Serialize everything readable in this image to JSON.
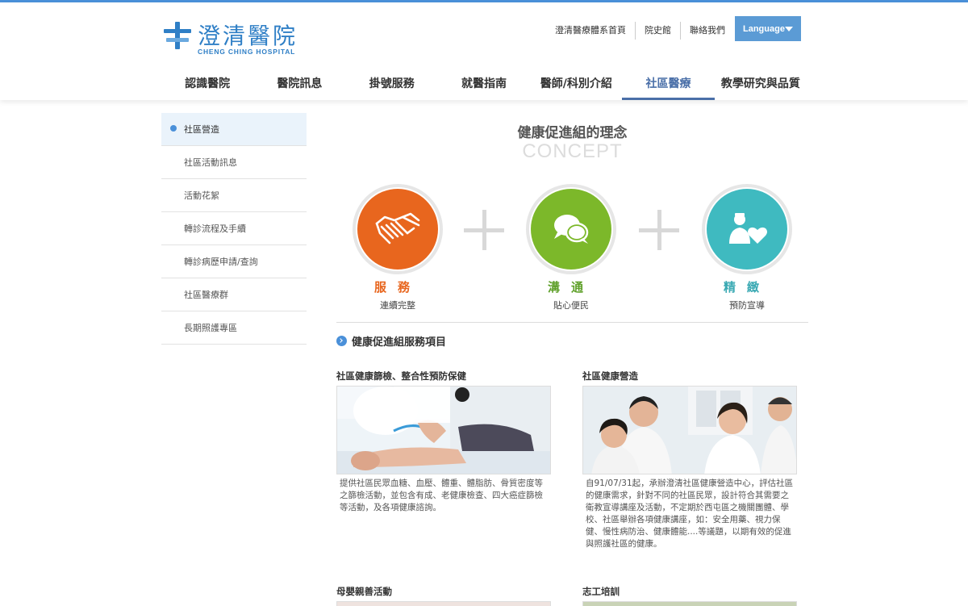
{
  "logo": {
    "title": "澄清醫院",
    "subtitle": "CHENG CHING HOSPITAL",
    "brand_color": "#2f7fc6"
  },
  "top_links": [
    "澄清醫療體系首頁",
    "院史館",
    "聯絡我們"
  ],
  "language_button": "Language",
  "main_nav": [
    {
      "label": "認識醫院",
      "active": false
    },
    {
      "label": "醫院訊息",
      "active": false
    },
    {
      "label": "掛號服務",
      "active": false
    },
    {
      "label": "就醫指南",
      "active": false
    },
    {
      "label": "醫師/科別介紹",
      "active": false
    },
    {
      "label": "社區醫療",
      "active": true
    },
    {
      "label": "教學研究與品質",
      "active": false
    }
  ],
  "sidebar": [
    {
      "label": "社區營造",
      "active": true
    },
    {
      "label": "社區活動訊息",
      "active": false
    },
    {
      "label": "活動花絮",
      "active": false
    },
    {
      "label": "轉診流程及手續",
      "active": false
    },
    {
      "label": "轉診病歷申請/查詢",
      "active": false
    },
    {
      "label": "社區醫療群",
      "active": false
    },
    {
      "label": "長期照護專區",
      "active": false
    }
  ],
  "concept": {
    "title": "健康促進組的理念",
    "subtitle_en": "CONCEPT",
    "items": [
      {
        "label": "服務",
        "sub": "連續完整",
        "color": "#e8661e",
        "label_color": "#e8661e",
        "icon": "handshake-icon"
      },
      {
        "label": "溝通",
        "sub": "貼心便民",
        "color": "#7cb82a",
        "label_color": "#5fa02a",
        "icon": "chat-bubbles-icon"
      },
      {
        "label": "精緻",
        "sub": "預防宣導",
        "color": "#3fbac0",
        "label_color": "#3aa9b3",
        "icon": "doctor-heart-icon"
      }
    ]
  },
  "services": {
    "heading": "健康促進組服務項目",
    "cards": [
      {
        "title": "社區健康篩檢、整合性預防保健",
        "description": "提供社區民眾血糖、血壓、體重、體脂肪、骨質密度等之篩檢活動，並包含有成、老健康檢查、四大癌症篩檢等活動，及各項健康諮詢。"
      },
      {
        "title": "社區健康營造",
        "description": "自91/07/31起，承辦澄清社區健康營造中心，評估社區的健康需求，針對不同的社區民眾，設計符合其需要之衛教宣導講座及活動，不定期於西屯區之機關團體、學校、社區舉辦各項健康講座，如：安全用藥、視力保健、慢性病防治、健康體能....等議題，以期有效的促進與照護社區的健康。"
      },
      {
        "title": "母嬰親善活動",
        "description": ""
      },
      {
        "title": "志工培訓",
        "description": ""
      }
    ]
  }
}
